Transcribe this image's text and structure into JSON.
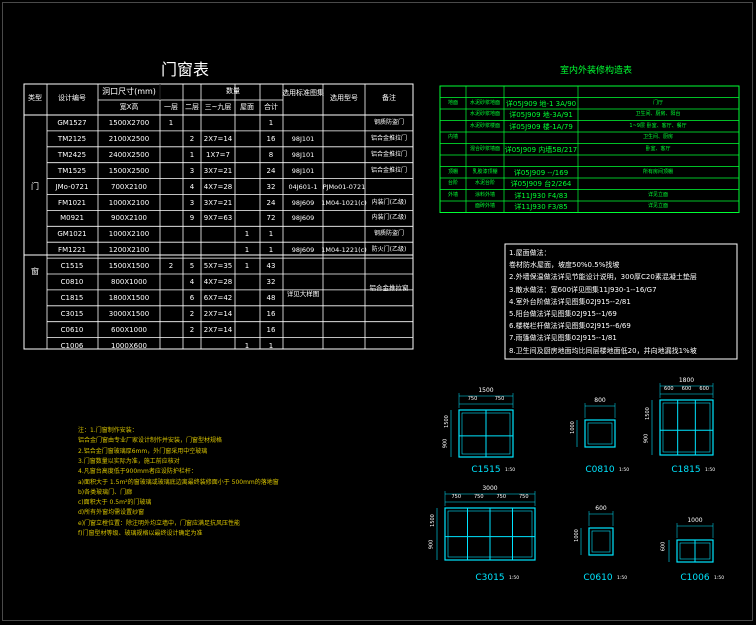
{
  "door_window_table": {
    "title": "门窗表",
    "headers": {
      "category": "类型",
      "code": "设计编号",
      "size_group": "洞口尺寸(mm)",
      "size_sub": "宽X高",
      "qty_group": "数量",
      "floor1": "一层",
      "floor2": "二层",
      "floor39": "三~九层",
      "roof": "屋面",
      "total": "合计",
      "std_drawing": "选用标准图集",
      "std_no": "选用型号",
      "remark": "备注"
    },
    "door_label": "门",
    "window_label": "窗",
    "rows": [
      {
        "code": "GM1527",
        "size": "1500X2700",
        "floor1": "1",
        "floor2": "",
        "floor39": "",
        "roof": "",
        "total": "1",
        "std": "",
        "model": "",
        "remark": "钢质防盗门"
      },
      {
        "code": "TM2125",
        "size": "2100X2500",
        "floor1": "",
        "floor2": "2",
        "floor39": "2X7=14",
        "roof": "",
        "total": "16",
        "std": "98J101",
        "model": "",
        "remark": "铝合金推拉门"
      },
      {
        "code": "TM2425",
        "size": "2400X2500",
        "floor1": "",
        "floor2": "1",
        "floor39": "1X7=7",
        "roof": "",
        "total": "8",
        "std": "98J101",
        "model": "",
        "remark": "铝合金推拉门"
      },
      {
        "code": "TM1525",
        "size": "1500X2500",
        "floor1": "",
        "floor2": "3",
        "floor39": "3X7=21",
        "roof": "",
        "total": "24",
        "std": "98J101",
        "model": "",
        "remark": "铝合金推拉门"
      },
      {
        "code": "JMo-0721",
        "size": "700X2100",
        "floor1": "",
        "floor2": "4",
        "floor39": "4X7=28",
        "roof": "",
        "total": "32",
        "std": "04J601-1",
        "model": "PJMo01-0721",
        "remark": ""
      },
      {
        "code": "FM1021",
        "size": "1000X2100",
        "floor1": "",
        "floor2": "3",
        "floor39": "3X7=21",
        "roof": "",
        "total": "24",
        "std": "98J609",
        "model": "1M04-1021(c)",
        "remark": "内装门(乙级)"
      },
      {
        "code": "M0921",
        "size": "900X2100",
        "floor1": "",
        "floor2": "9",
        "floor39": "9X7=63",
        "roof": "",
        "total": "72",
        "std": "98J609",
        "model": "",
        "remark": "内装门(乙级)"
      },
      {
        "code": "GM1021",
        "size": "1000X2100",
        "floor1": "",
        "floor2": "",
        "floor39": "",
        "roof": "1",
        "total": "1",
        "std": "",
        "model": "",
        "remark": "钢质防盗门"
      },
      {
        "code": "FM1221",
        "size": "1200X2100",
        "floor1": "",
        "floor2": "",
        "floor39": "",
        "roof": "1",
        "total": "1",
        "std": "98J609",
        "model": "1M04-1221(c)",
        "remark": "防火门(乙级)"
      },
      {
        "code": "C1515",
        "size": "1500X1500",
        "floor1": "2",
        "floor2": "5",
        "floor39": "5X7=35",
        "roof": "1",
        "total": "43",
        "std": "",
        "model": "",
        "remark": ""
      },
      {
        "code": "C0810",
        "size": "800X1000",
        "floor1": "",
        "floor2": "4",
        "floor39": "4X7=28",
        "roof": "",
        "total": "32",
        "std": "",
        "model": "",
        "remark": ""
      },
      {
        "code": "C1815",
        "size": "1800X1500",
        "floor1": "",
        "floor2": "6",
        "floor39": "6X7=42",
        "roof": "",
        "total": "48",
        "std": "",
        "model": "",
        "remark": ""
      },
      {
        "code": "C3015",
        "size": "3000X1500",
        "floor1": "",
        "floor2": "2",
        "floor39": "2X7=14",
        "roof": "",
        "total": "16",
        "std": "",
        "model": "",
        "remark": ""
      },
      {
        "code": "C0610",
        "size": "600X1000",
        "floor1": "",
        "floor2": "2",
        "floor39": "2X7=14",
        "roof": "",
        "total": "16",
        "std": "",
        "model": "",
        "remark": ""
      },
      {
        "code": "C1006",
        "size": "1000X600",
        "floor1": "",
        "floor2": "",
        "floor39": "",
        "roof": "1",
        "total": "1",
        "std": "",
        "model": "",
        "remark": ""
      }
    ],
    "window_std": "详见大样图",
    "window_remark": "铝合金推拉窗"
  },
  "finish_table": {
    "title": "室内外装修构造表",
    "rows": [
      {
        "part": "",
        "name": "",
        "code": "",
        "scope": ""
      },
      {
        "part": "地面",
        "name": "水泥砂浆地面",
        "code": "详05J909 地-1 3A/90",
        "scope": "门厅"
      },
      {
        "part": "",
        "name": "水泥砂浆地面",
        "code": "详05J909 地-3A/91",
        "scope": "卫生间、厨房、阳台"
      },
      {
        "part": "",
        "name": "水泥砂浆楼面",
        "code": "详05J909 楼-1A/79",
        "scope": "1~9层 卧室、客厅、餐厅"
      },
      {
        "part": "内墙",
        "name": "",
        "code": "",
        "scope": "卫生间、厨房"
      },
      {
        "part": "",
        "name": "混合砂浆墙面",
        "code": "详05J909 内墙5B/217",
        "scope": "卧室、客厅"
      },
      {
        "part": "",
        "name": "",
        "code": "",
        "scope": ""
      },
      {
        "part": "顶棚",
        "name": "乳胶漆顶棚",
        "code": "详05J909 --/169",
        "scope": "所有房间顶棚"
      },
      {
        "part": "台阶",
        "name": "水泥台阶",
        "code": "详05J909 台2/264",
        "scope": ""
      },
      {
        "part": "外墙",
        "name": "涂料外墙",
        "code": "详11J930 F4/83",
        "scope": "详见立面"
      },
      {
        "part": "",
        "name": "面砖外墙",
        "code": "详11J930 F3/85",
        "scope": "详见立面"
      }
    ]
  },
  "notes_right": [
    "1.屋面做法：",
    "  卷材防水屋面，坡度50%0.5%找坡",
    "2.外墙保温做法详见节能设计说明，300厚C20素混凝土垫层",
    "3.散水做法：宽600详见图集11J930-1--16/G7",
    "4.室外台阶做法详见图集02J915--2/81",
    "5.阳台做法详见图集02J915--1/69",
    "6.楼梯栏杆做法详见图集02J915--6/69",
    "7.雨篷做法详见图集02J915--1/81",
    "8.卫生间及厨房地面均比同层楼地面低20，并向地漏找1%坡"
  ],
  "notes_left": [
    "注：1.门窗制作安装：",
    "  铝合金门窗由专业厂家设计制作并安装，门窗型材规格",
    "2.铝合金门窗玻璃厚6mm，外门窗采用中空玻璃",
    "3.门窗数量以实际为准，施工前应核对",
    "4.凡窗台高度低于900mm者应设防护栏杆：",
    "a)面积大于 1.5m²的窗玻璃或玻璃底边离最终装修面小于 500mm的落地窗",
    "b)各类玻璃门、门廊",
    "c)面积大于 0.5m²的门玻璃",
    "d)所有外窗均需设置纱窗",
    "e)门窗立樘位置：除注明外均立墙中，门窗应满足抗风压性能",
    "f)门窗型材等级、玻璃规格以最终设计确定为准"
  ],
  "note_500": "500mm的落地窗",
  "elevations": [
    {
      "label": "C1515",
      "scale": "1:50",
      "overall": "1500",
      "dims": [
        "750",
        "750"
      ]
    },
    {
      "label": "C0810",
      "scale": "1:50",
      "overall": "800",
      "dims": []
    },
    {
      "label": "C1815",
      "scale": "1:50",
      "overall": "1800",
      "dims": [
        "600",
        "600",
        "600"
      ]
    },
    {
      "label": "C3015",
      "scale": "1:50",
      "overall": "3000",
      "dims": [
        "750",
        "750",
        "750",
        "750"
      ]
    },
    {
      "label": "C0610",
      "scale": "1:50",
      "overall": "600",
      "dims": []
    },
    {
      "label": "C1006",
      "scale": "1:50",
      "overall": "1000",
      "dims": []
    }
  ],
  "vertical_dims": {
    "c1515": [
      "1500",
      "900"
    ],
    "c0810": [
      "1000"
    ],
    "c1815": [
      "1500",
      "900"
    ],
    "c3015": [
      "1500",
      "900"
    ],
    "c0610": [
      "1000"
    ],
    "c1006": [
      "600"
    ]
  },
  "colors": {
    "background": "#000000",
    "table_lines": "#ffffff",
    "finish_lines": "#00ff33",
    "notes": "#d9c400",
    "elevation": "#00e5ff"
  }
}
